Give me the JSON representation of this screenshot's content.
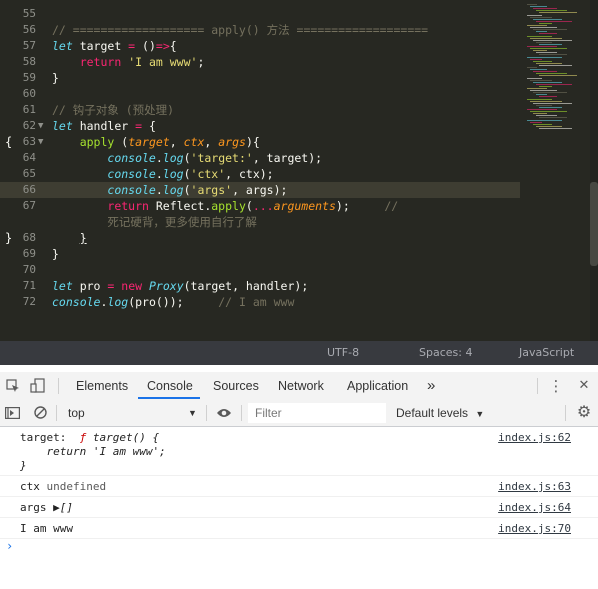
{
  "editor": {
    "lines": [
      {
        "num": "55",
        "tokens": []
      },
      {
        "num": "56",
        "tokens": [
          {
            "c": "tk-comment",
            "t": "// =================== apply() 方法 ==================="
          }
        ]
      },
      {
        "num": "57",
        "tokens": [
          {
            "c": "tk-kw",
            "t": "let"
          },
          {
            "c": "tk-text",
            "t": " target "
          },
          {
            "c": "tk-red",
            "t": "="
          },
          {
            "c": "tk-text",
            "t": " ()"
          },
          {
            "c": "tk-red",
            "t": "=>"
          },
          {
            "c": "tk-text",
            "t": "{"
          }
        ]
      },
      {
        "num": "58",
        "tokens": [
          {
            "c": "tk-text",
            "t": "    "
          },
          {
            "c": "tk-red",
            "t": "return"
          },
          {
            "c": "tk-text",
            "t": " "
          },
          {
            "c": "tk-str",
            "t": "'I am www'"
          },
          {
            "c": "tk-text",
            "t": ";"
          }
        ]
      },
      {
        "num": "59",
        "tokens": [
          {
            "c": "tk-text",
            "t": "}"
          }
        ]
      },
      {
        "num": "60",
        "tokens": []
      },
      {
        "num": "61",
        "tokens": [
          {
            "c": "tk-comment",
            "t": "// 钩子对象 (预处理)"
          }
        ]
      },
      {
        "num": "62",
        "fold": "▼",
        "tokens": [
          {
            "c": "tk-kw",
            "t": "let"
          },
          {
            "c": "tk-text",
            "t": " handler "
          },
          {
            "c": "tk-red",
            "t": "="
          },
          {
            "c": "tk-text",
            "t": " {"
          }
        ]
      },
      {
        "num": "63",
        "fold": "▼",
        "brace": "{",
        "tokens": [
          {
            "c": "tk-text",
            "t": "    "
          },
          {
            "c": "tk-fn",
            "t": "apply"
          },
          {
            "c": "tk-text",
            "t": " ("
          },
          {
            "c": "tk-param",
            "t": "target"
          },
          {
            "c": "tk-text",
            "t": ", "
          },
          {
            "c": "tk-param",
            "t": "ctx"
          },
          {
            "c": "tk-text",
            "t": ", "
          },
          {
            "c": "tk-param",
            "t": "args"
          },
          {
            "c": "tk-text",
            "t": "){"
          }
        ]
      },
      {
        "num": "64",
        "tokens": [
          {
            "c": "tk-text",
            "t": "        "
          },
          {
            "c": "tk-ital",
            "t": "console"
          },
          {
            "c": "tk-text",
            "t": "."
          },
          {
            "c": "tk-kw",
            "t": "log"
          },
          {
            "c": "tk-text",
            "t": "("
          },
          {
            "c": "tk-str",
            "t": "'target:'"
          },
          {
            "c": "tk-text",
            "t": ", target);"
          }
        ]
      },
      {
        "num": "65",
        "tokens": [
          {
            "c": "tk-text",
            "t": "        "
          },
          {
            "c": "tk-ital",
            "t": "console"
          },
          {
            "c": "tk-text",
            "t": "."
          },
          {
            "c": "tk-kw",
            "t": "log"
          },
          {
            "c": "tk-text",
            "t": "("
          },
          {
            "c": "tk-str",
            "t": "'ctx'"
          },
          {
            "c": "tk-text",
            "t": ", ctx);"
          }
        ]
      },
      {
        "num": "66",
        "hl": true,
        "tokens": [
          {
            "c": "tk-text",
            "t": "        "
          },
          {
            "c": "tk-ital",
            "t": "console"
          },
          {
            "c": "tk-text",
            "t": "."
          },
          {
            "c": "tk-kw",
            "t": "log"
          },
          {
            "c": "tk-text",
            "t": "("
          },
          {
            "c": "tk-str",
            "t": "'args'"
          },
          {
            "c": "tk-text",
            "t": ", args);"
          }
        ]
      },
      {
        "num": "67",
        "tokens": [
          {
            "c": "tk-text",
            "t": "        "
          },
          {
            "c": "tk-red",
            "t": "return"
          },
          {
            "c": "tk-text",
            "t": " Reflect."
          },
          {
            "c": "tk-fn",
            "t": "apply"
          },
          {
            "c": "tk-text",
            "t": "("
          },
          {
            "c": "tk-red",
            "t": "..."
          },
          {
            "c": "tk-param",
            "t": "arguments"
          },
          {
            "c": "tk-text",
            "t": ");     "
          },
          {
            "c": "tk-comment",
            "t": "//"
          }
        ]
      },
      {
        "num": "",
        "tokens": [
          {
            "c": "tk-text",
            "t": "        "
          },
          {
            "c": "tk-comment",
            "t": "死记硬背，更多使用自行了解"
          }
        ]
      },
      {
        "num": "68",
        "brace": "}",
        "tokens": [
          {
            "c": "tk-text",
            "t": "    "
          },
          {
            "c": "tk-text tk-ul",
            "t": "}"
          }
        ]
      },
      {
        "num": "69",
        "tokens": [
          {
            "c": "tk-text",
            "t": "}"
          }
        ]
      },
      {
        "num": "70",
        "tokens": []
      },
      {
        "num": "71",
        "tokens": [
          {
            "c": "tk-kw",
            "t": "let"
          },
          {
            "c": "tk-text",
            "t": " pro "
          },
          {
            "c": "tk-red",
            "t": "="
          },
          {
            "c": "tk-text",
            "t": " "
          },
          {
            "c": "tk-red",
            "t": "new"
          },
          {
            "c": "tk-text",
            "t": " "
          },
          {
            "c": "tk-ital",
            "t": "Proxy"
          },
          {
            "c": "tk-text",
            "t": "(target, handler);"
          }
        ]
      },
      {
        "num": "72",
        "tokens": [
          {
            "c": "tk-ital",
            "t": "console"
          },
          {
            "c": "tk-text",
            "t": "."
          },
          {
            "c": "tk-kw",
            "t": "log"
          },
          {
            "c": "tk-text",
            "t": "(pro());     "
          },
          {
            "c": "tk-comment",
            "t": "// I am www"
          }
        ]
      }
    ]
  },
  "statusbar": {
    "encoding": "UTF-8",
    "spaces": "Spaces: 4",
    "language": "JavaScript"
  },
  "devtools": {
    "tabs": [
      "Elements",
      "Console",
      "Sources",
      "Network",
      "Application"
    ],
    "more": "»",
    "menu": "⋮",
    "close": "✕"
  },
  "toolbar": {
    "context": "top",
    "filter_placeholder": "Filter",
    "levels": "Default levels"
  },
  "console": {
    "messages": [
      {
        "kind": "target",
        "label": "target:",
        "fn_prefix": "ƒ",
        "fn_sig": "target() {",
        "fn_body": "    return 'I am www';",
        "fn_end": "}",
        "source": "index.js:62"
      },
      {
        "kind": "text",
        "text": "ctx",
        "value": "undefined",
        "source": "index.js:63"
      },
      {
        "kind": "args",
        "text": "args",
        "value": "▶[]",
        "source": "index.js:64"
      },
      {
        "kind": "text",
        "text": "I am www",
        "value": "",
        "source": "index.js:70"
      }
    ],
    "prompt": "›"
  }
}
